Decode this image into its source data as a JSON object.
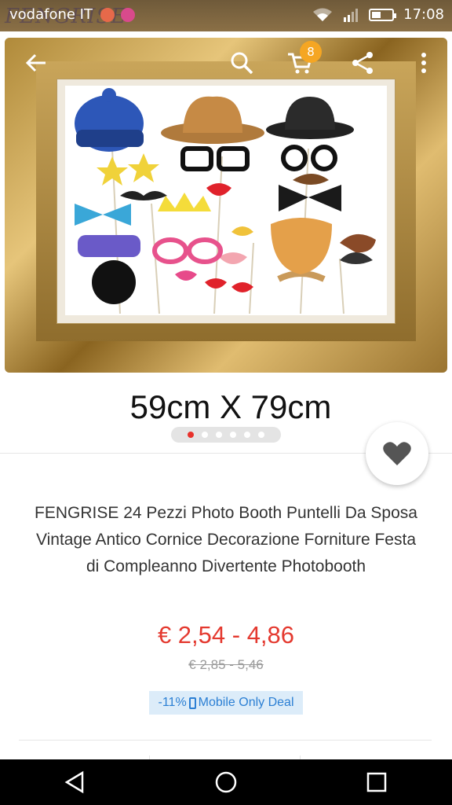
{
  "status_bar": {
    "carrier": "vodafone IT",
    "brand_overlay": "FENGRISE",
    "time": "17:08",
    "notification_colors": [
      "#e6694a",
      "#d94a8c"
    ]
  },
  "toolbar": {
    "back_icon": "arrow-left-icon",
    "search_icon": "search-icon",
    "cart_icon": "cart-icon",
    "cart_count": "8",
    "share_icon": "share-icon",
    "more_icon": "more-vertical-icon"
  },
  "hero": {
    "size_caption": "59cm X 79cm",
    "pager_count": 6,
    "pager_active": 0
  },
  "product": {
    "title": "FENGRISE 24 Pezzi Photo Booth Puntelli Da Sposa Vintage Antico Cornice Decorazione Forniture Festa di Compleanno Divertente Photobooth",
    "price": "€ 2,54 - 4,86",
    "old_price": "€ 2,85 - 5,46",
    "deal_percent": "-11%",
    "deal_label": "Mobile Only Deal",
    "favorite_icon": "heart-icon"
  },
  "nav_bar": {
    "back_icon": "triangle-back-icon",
    "home_icon": "circle-home-icon",
    "recents_icon": "square-recents-icon"
  },
  "colors": {
    "price": "#e4392f",
    "deal_bg": "#dcecf9",
    "deal_text": "#2b7fd4",
    "badge": "#f5a623",
    "pager_active": "#e8312b"
  }
}
